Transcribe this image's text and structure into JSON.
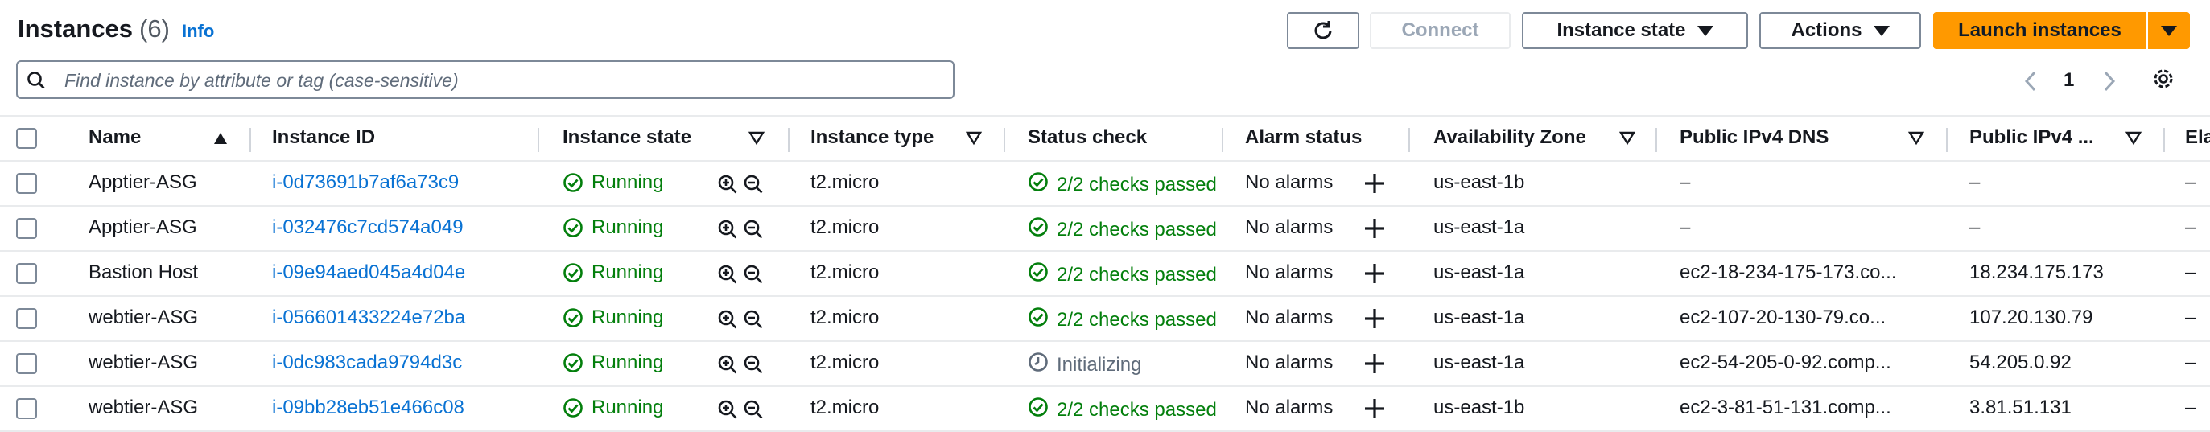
{
  "header": {
    "title": "Instances",
    "count": "(6)",
    "info": "Info"
  },
  "toolbar": {
    "connect": "Connect",
    "instance_state": "Instance state",
    "actions": "Actions",
    "launch": "Launch instances"
  },
  "search": {
    "placeholder": "Find instance by attribute or tag (case-sensitive)"
  },
  "pagination": {
    "page": "1"
  },
  "columns": {
    "name": "Name",
    "instance_id": "Instance ID",
    "instance_state": "Instance state",
    "instance_type": "Instance type",
    "status_check": "Status check",
    "alarm_status": "Alarm status",
    "availability_zone": "Availability Zone",
    "public_dns": "Public IPv4 DNS",
    "public_ip": "Public IPv4 ...",
    "elastic": "Ela"
  },
  "rows": [
    {
      "name": "Apptier-ASG",
      "id": "i-0d73691b7af6a73c9",
      "state": "Running",
      "type": "t2.micro",
      "status": "2/2 checks passed",
      "status_kind": "passed",
      "alarm": "No alarms",
      "az": "us-east-1b",
      "dns": "–",
      "ip": "–",
      "elastic": "–"
    },
    {
      "name": "Apptier-ASG",
      "id": "i-032476c7cd574a049",
      "state": "Running",
      "type": "t2.micro",
      "status": "2/2 checks passed",
      "status_kind": "passed",
      "alarm": "No alarms",
      "az": "us-east-1a",
      "dns": "–",
      "ip": "–",
      "elastic": "–"
    },
    {
      "name": "Bastion Host",
      "id": "i-09e94aed045a4d04e",
      "state": "Running",
      "type": "t2.micro",
      "status": "2/2 checks passed",
      "status_kind": "passed",
      "alarm": "No alarms",
      "az": "us-east-1a",
      "dns": "ec2-18-234-175-173.co...",
      "ip": "18.234.175.173",
      "elastic": "–"
    },
    {
      "name": "webtier-ASG",
      "id": "i-056601433224e72ba",
      "state": "Running",
      "type": "t2.micro",
      "status": "2/2 checks passed",
      "status_kind": "passed",
      "alarm": "No alarms",
      "az": "us-east-1a",
      "dns": "ec2-107-20-130-79.co...",
      "ip": "107.20.130.79",
      "elastic": "–"
    },
    {
      "name": "webtier-ASG",
      "id": "i-0dc983cada9794d3c",
      "state": "Running",
      "type": "t2.micro",
      "status": "Initializing",
      "status_kind": "initializing",
      "alarm": "No alarms",
      "az": "us-east-1a",
      "dns": "ec2-54-205-0-92.comp...",
      "ip": "54.205.0.92",
      "elastic": "–"
    },
    {
      "name": "webtier-ASG",
      "id": "i-09bb28eb51e466c08",
      "state": "Running",
      "type": "t2.micro",
      "status": "2/2 checks passed",
      "status_kind": "passed",
      "alarm": "No alarms",
      "az": "us-east-1b",
      "dns": "ec2-3-81-51-131.comp...",
      "ip": "3.81.51.131",
      "elastic": "–"
    }
  ],
  "colors": {
    "accent": "#ff9900",
    "link": "#0972d3",
    "success": "#037f0c",
    "border": "#7d8998"
  }
}
